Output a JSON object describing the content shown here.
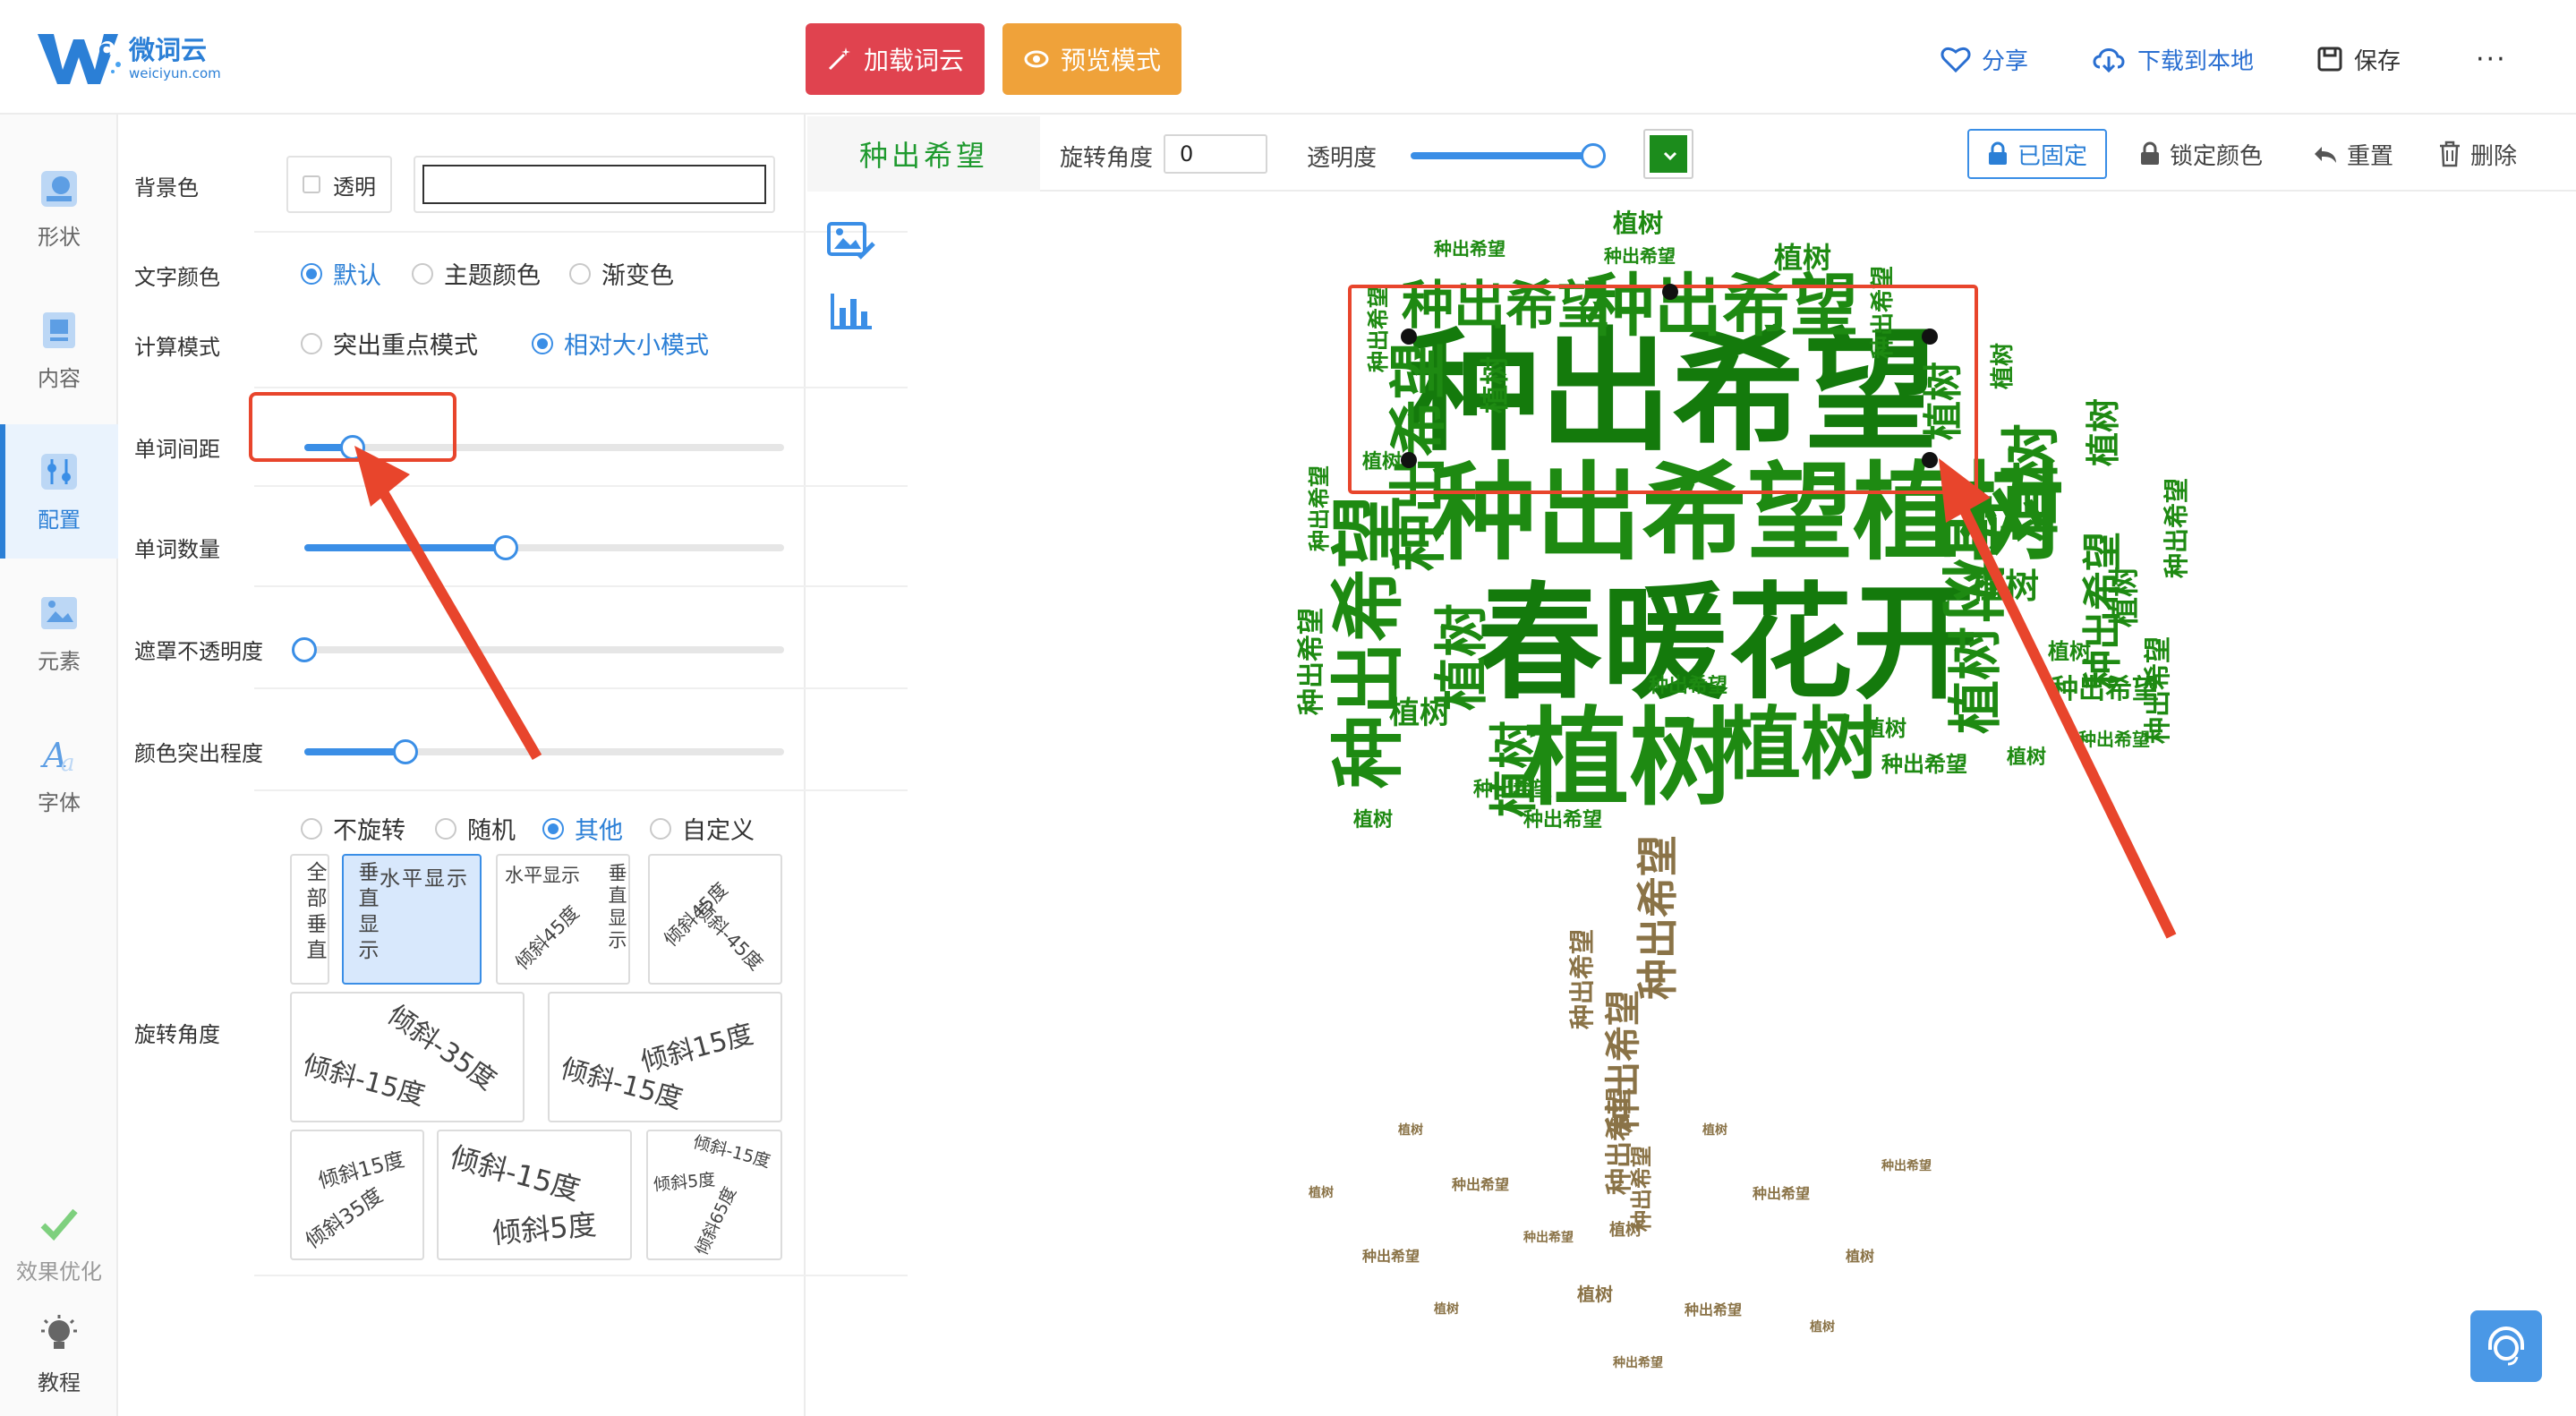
{
  "header": {
    "logo_name": "微词云",
    "logo_url": "weiciyun.com",
    "load_button": "加载词云",
    "preview_button": "预览模式",
    "share": "分享",
    "download": "下载到本地",
    "save": "保存",
    "more": "···"
  },
  "rail": {
    "items": [
      {
        "label": "形状"
      },
      {
        "label": "内容"
      },
      {
        "label": "配置"
      },
      {
        "label": "元素"
      },
      {
        "label": "字体"
      }
    ],
    "optimize": "效果优化",
    "tutorial": "教程"
  },
  "panel": {
    "bg_label": "背景色",
    "transparent_label": "透明",
    "bg_value": "",
    "text_color_label": "文字颜色",
    "text_color_options": [
      "默认",
      "主题颜色",
      "渐变色"
    ],
    "text_color_selected": "默认",
    "calc_mode_label": "计算模式",
    "calc_mode_options": [
      "突出重点模式",
      "相对大小模式"
    ],
    "calc_mode_selected": "相对大小模式",
    "spacing_label": "单词间距",
    "spacing_value": 0.1,
    "count_label": "单词数量",
    "count_value": 0.42,
    "mask_label": "遮罩不透明度",
    "mask_value": 0.0,
    "highlight_label": "颜色突出程度",
    "highlight_value": 0.21,
    "rotation_label": "旋转角度",
    "rotation_options": [
      "不旋转",
      "随机",
      "其他",
      "自定义"
    ],
    "rotation_selected": "其他",
    "rot_cards": {
      "c1": "全部垂直",
      "c2a": "垂直显示",
      "c2b": "水平显示",
      "c3a": "水平显示",
      "c3b": "倾斜45度",
      "c3c": "垂直显示",
      "c4a": "倾斜45度",
      "c4b": "倾斜-45度",
      "c5a": "倾斜-35度",
      "c5b": "倾斜-15度",
      "c6a": "倾斜15度",
      "c6b": "倾斜-15度",
      "c7a": "倾斜15度",
      "c7b": "倾斜35度",
      "c8a": "倾斜-15度",
      "c8b": "倾斜5度",
      "c9a": "倾斜-15度",
      "c9b": "倾斜5度",
      "c9c": "倾斜65度"
    }
  },
  "toolbar": {
    "word": "种出希望",
    "rotate_label": "旋转角度",
    "rotate_value": "0",
    "opacity_label": "透明度",
    "opacity_value": 1.0,
    "color": "#1c8c1c",
    "fixed": "已固定",
    "lock_color": "锁定颜色",
    "reset": "重置",
    "delete": "删除"
  },
  "cloud": {
    "word_a": "种出希望",
    "word_b": "植树",
    "word_c": "春暖花开",
    "word_d": "种出希望植树",
    "green": "#1e8a12",
    "brown": "#8a7347"
  },
  "annotations": {
    "highlight_color": "#e8452c"
  }
}
